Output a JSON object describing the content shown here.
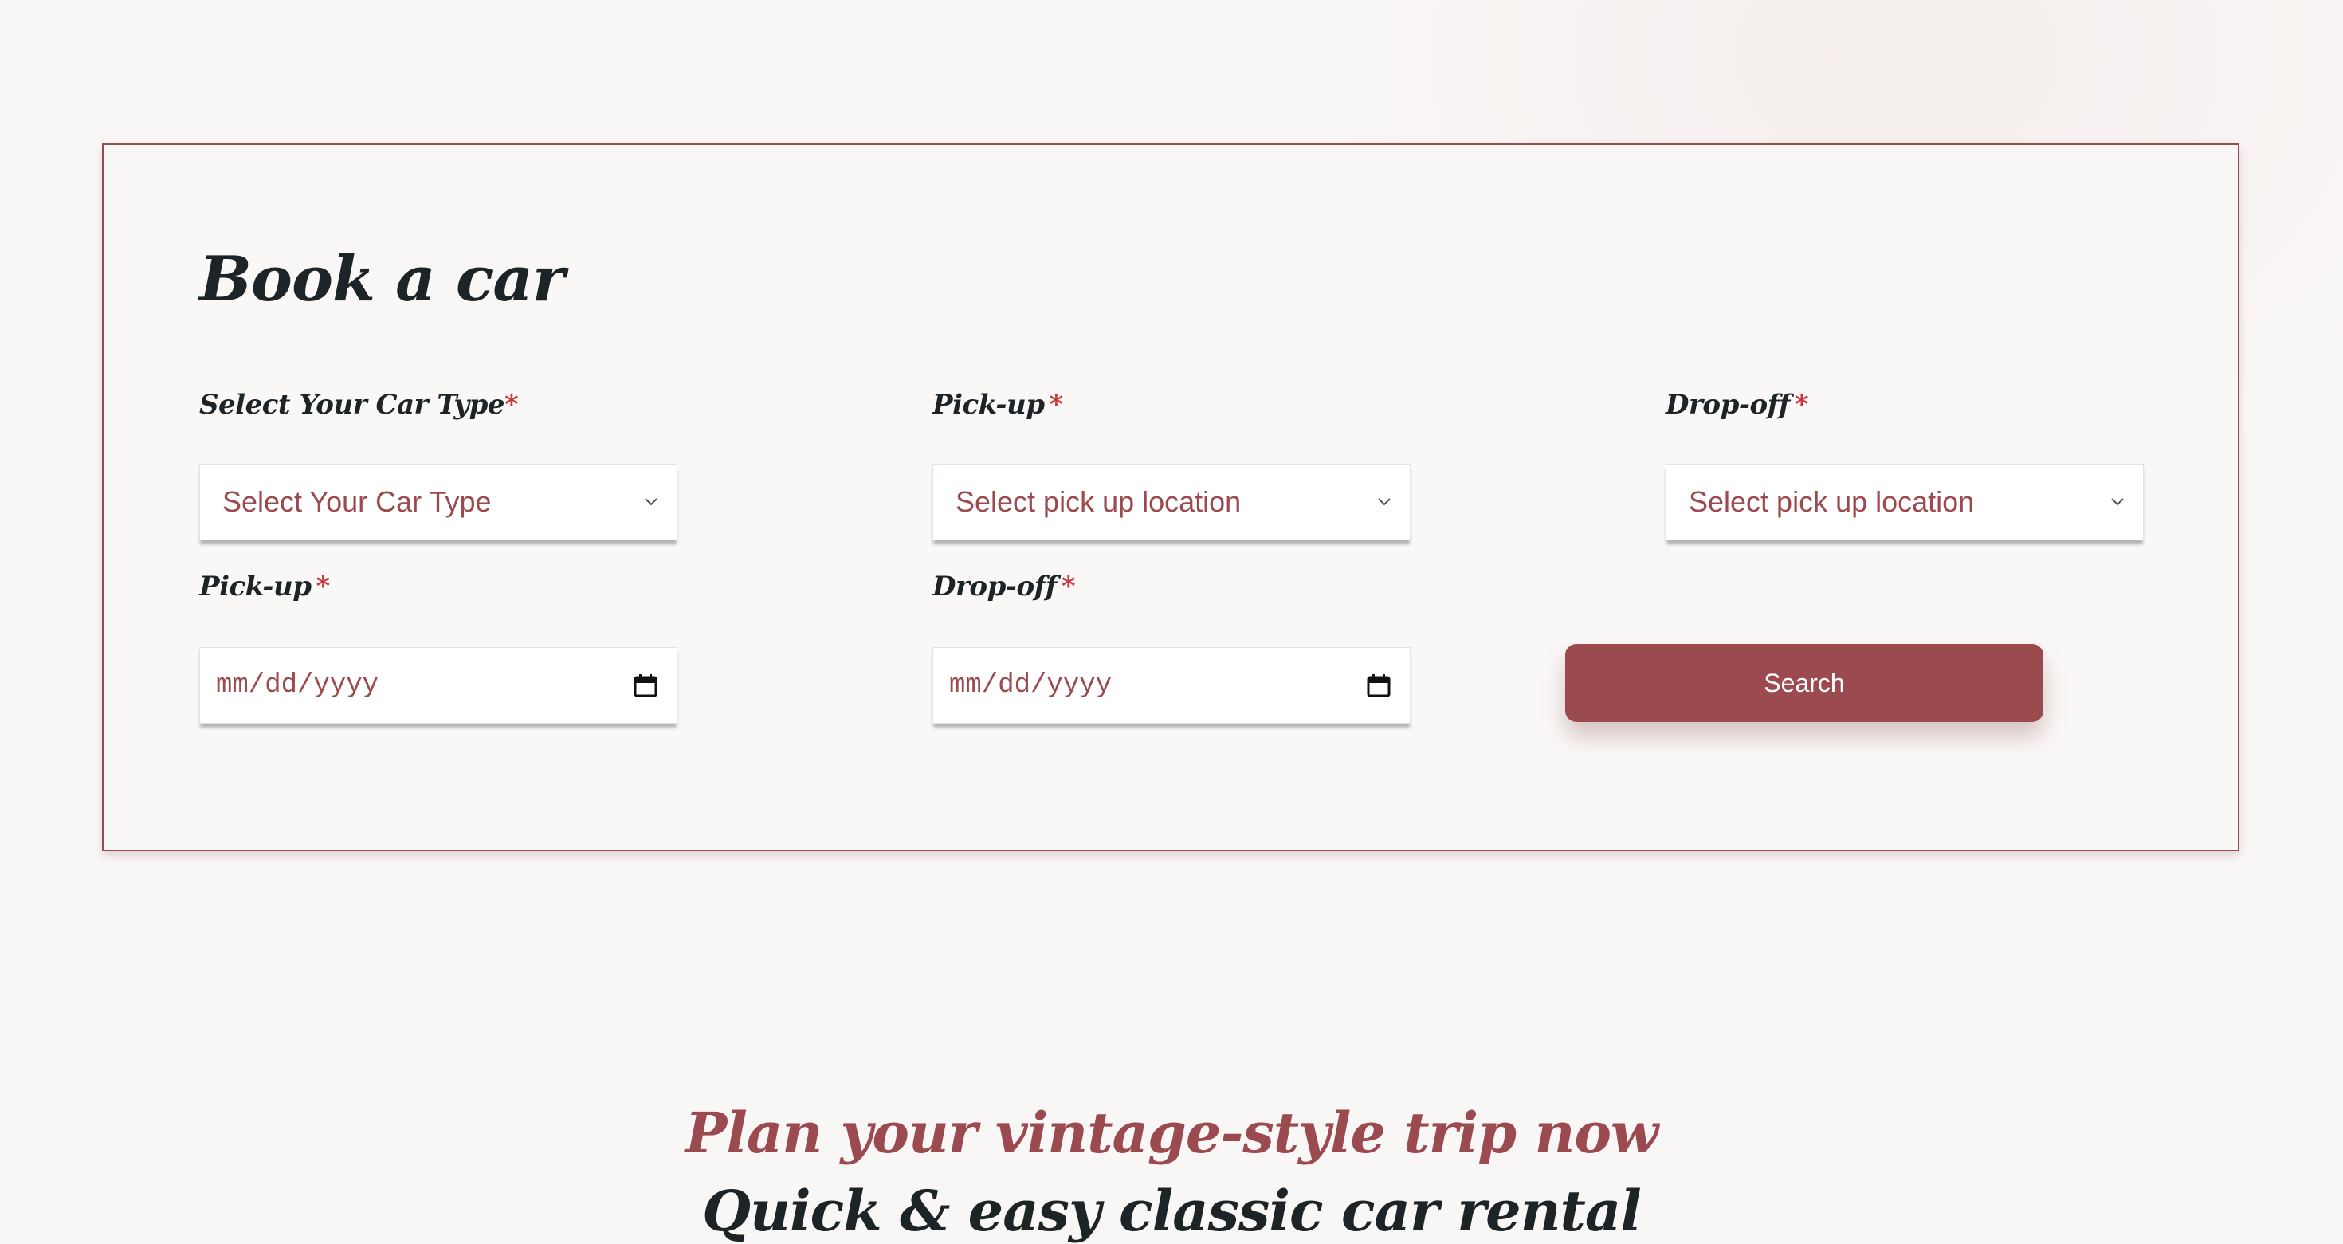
{
  "booking": {
    "title": "Book a car",
    "required_mark": "*",
    "car_type": {
      "label": "Select Your Car Type",
      "selected": "Select Your Car Type"
    },
    "pickup_location": {
      "label": "Pick-up",
      "selected": "Select pick up location"
    },
    "dropoff_location": {
      "label": "Drop-off",
      "selected": "Select pick up location"
    },
    "pickup_date": {
      "label": "Pick-up",
      "placeholder": "mm/dd/yyyy"
    },
    "dropoff_date": {
      "label": "Drop-off",
      "placeholder": "mm/dd/yyyy"
    },
    "search_label": "Search"
  },
  "section": {
    "tagline": "Plan your vintage-style trip now",
    "heading": "Quick & easy classic car rental"
  },
  "colors": {
    "accent": "#9b4a50",
    "required": "#c8353a",
    "text": "#1d2428",
    "background": "#f9f7f6"
  },
  "icons": {
    "select": "chevron-down-icon",
    "date": "calendar-icon"
  }
}
